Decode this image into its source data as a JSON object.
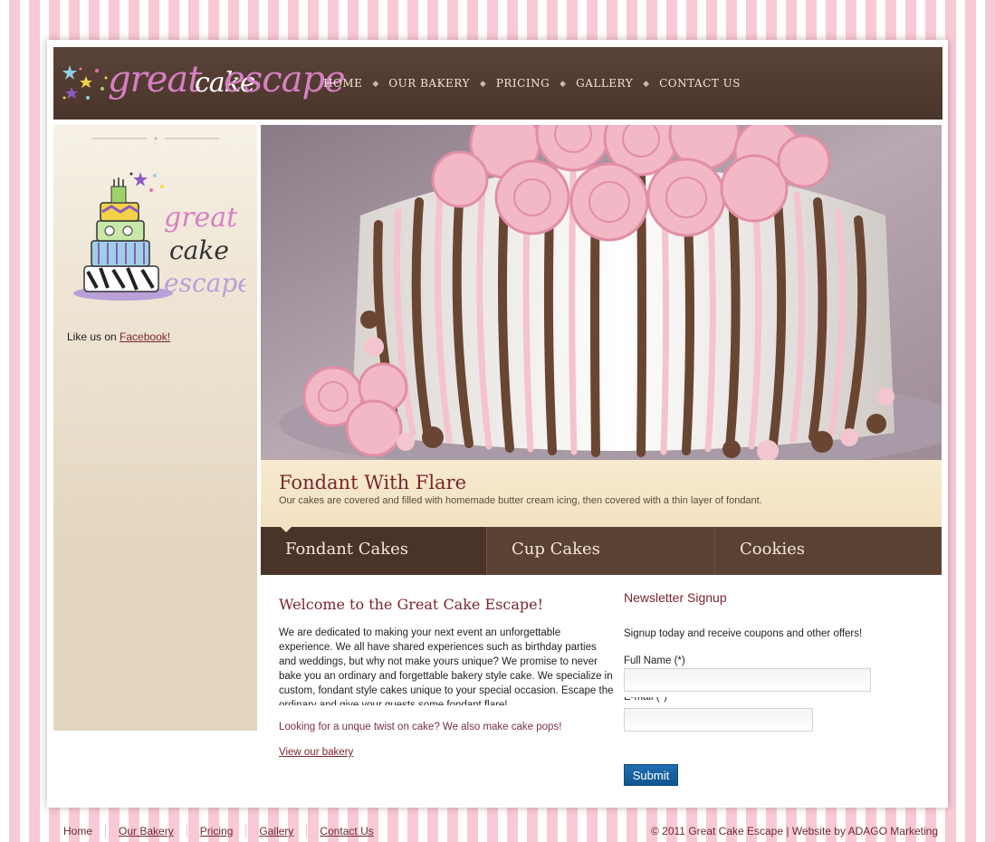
{
  "logo": {
    "part1": "great",
    "part2": "cake",
    "part3": "escape"
  },
  "nav": [
    {
      "label": "HOME"
    },
    {
      "label": "OUR BAKERY"
    },
    {
      "label": "PRICING"
    },
    {
      "label": "GALLERY"
    },
    {
      "label": "CONTACT US"
    }
  ],
  "sidebar": {
    "logo_text": [
      "great",
      "cake",
      "escape"
    ],
    "facebook_prefix": "Like us on",
    "facebook_link": "Facebook!"
  },
  "caption": {
    "title": "Fondant With Flare",
    "text": "Our cakes are covered and filled with homemade butter cream icing, then covered with a thin layer of fondant."
  },
  "tabs": [
    {
      "label": "Fondant Cakes"
    },
    {
      "label": "Cup Cakes"
    },
    {
      "label": "Cookies"
    }
  ],
  "welcome": {
    "title": "Welcome to the Great Cake Escape!",
    "body": "We are dedicated to making your next event an unforgettable experience. We all have shared experiences such as birthday parties and weddings, but why not make yours unique? We promise to never bake you an ordinary and forgettable bakery style cake. We specialize in custom, fondant style cakes unique to your special occasion. Escape the ordinary and give your guests some fondant flare!",
    "pops": "Looking for a unque twist on cake? We also make cake pops!",
    "link": "View our bakery"
  },
  "newsletter": {
    "title": "Newsletter Signup",
    "intro": "Signup today and receive coupons and other offers!",
    "name_label": "Full Name (*)",
    "email_label": "E-mail (*)",
    "submit": "Submit"
  },
  "footer": {
    "links": [
      "Home",
      "Our Bakery",
      "Pricing",
      "Gallery",
      "Contact Us"
    ],
    "copyright": "© 2011 Great Cake Escape | Website by ADAGO Marketing"
  },
  "colors": {
    "header_brown": "#4a352b",
    "accent_maroon": "#7a2630",
    "pink_stripe": "#f9c9d6",
    "caption_cream": "#f2e2c0",
    "submit_blue": "#1f6fb0"
  }
}
